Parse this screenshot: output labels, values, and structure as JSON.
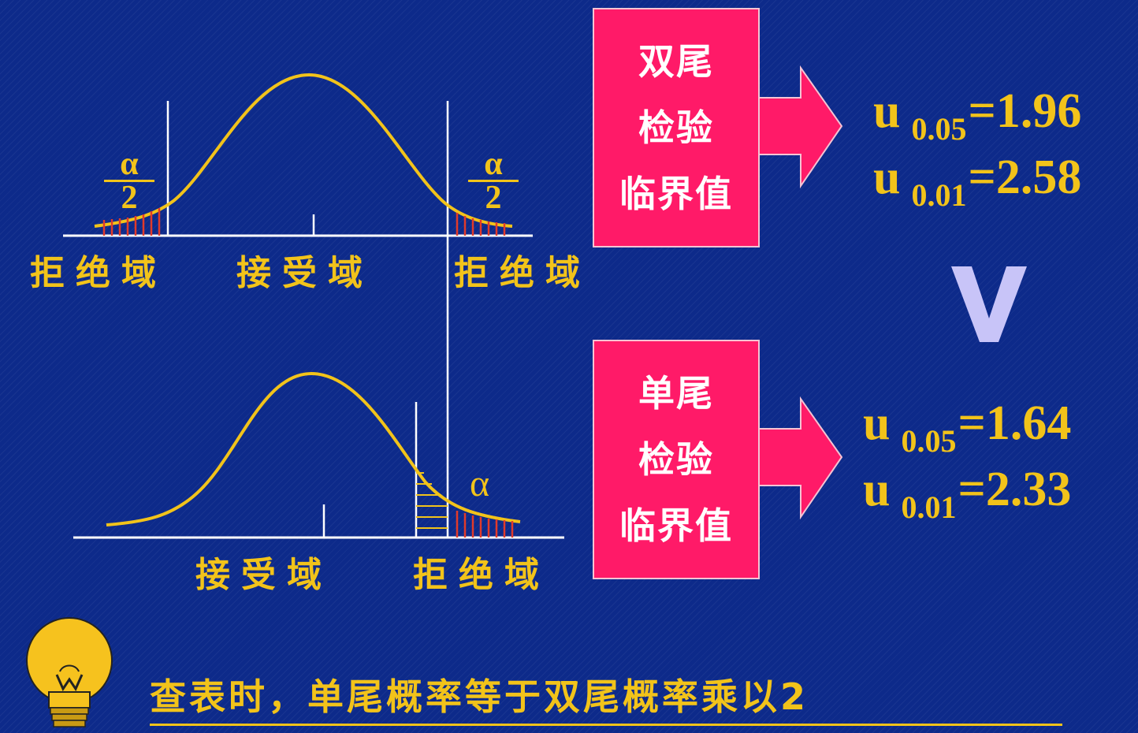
{
  "two_tailed": {
    "box_lines": [
      "双尾",
      "检验",
      "临界值"
    ],
    "values": [
      {
        "u": "u",
        "p": "0.05",
        "eq": "=1.96"
      },
      {
        "u": "u",
        "p": "0.01",
        "eq": "=2.58"
      }
    ],
    "alpha_label": {
      "num": "α",
      "den": "2"
    },
    "regions": {
      "left": "拒绝域",
      "center": "接受域",
      "right": "拒绝域"
    }
  },
  "one_tailed": {
    "box_lines": [
      "单尾",
      "检验",
      "临界值"
    ],
    "values": [
      {
        "u": "u",
        "p": "0.05",
        "eq": "=1.64"
      },
      {
        "u": "u",
        "p": "0.01",
        "eq": "=2.33"
      }
    ],
    "alpha_label": "α",
    "regions": {
      "center": "接受域",
      "right": "拒绝域"
    }
  },
  "comparison_symbol": "V",
  "note": "查表时，单尾概率等于双尾概率乘以2",
  "colors": {
    "background": "#0d2a8a",
    "accent_yellow": "#f2c31a",
    "box_pink": "#ff1a68",
    "hatch_red": "#e23a2a",
    "symbol_lavender": "#c8c4f8"
  },
  "icons": [
    "lightbulb-icon",
    "arrow-right-icon"
  ]
}
